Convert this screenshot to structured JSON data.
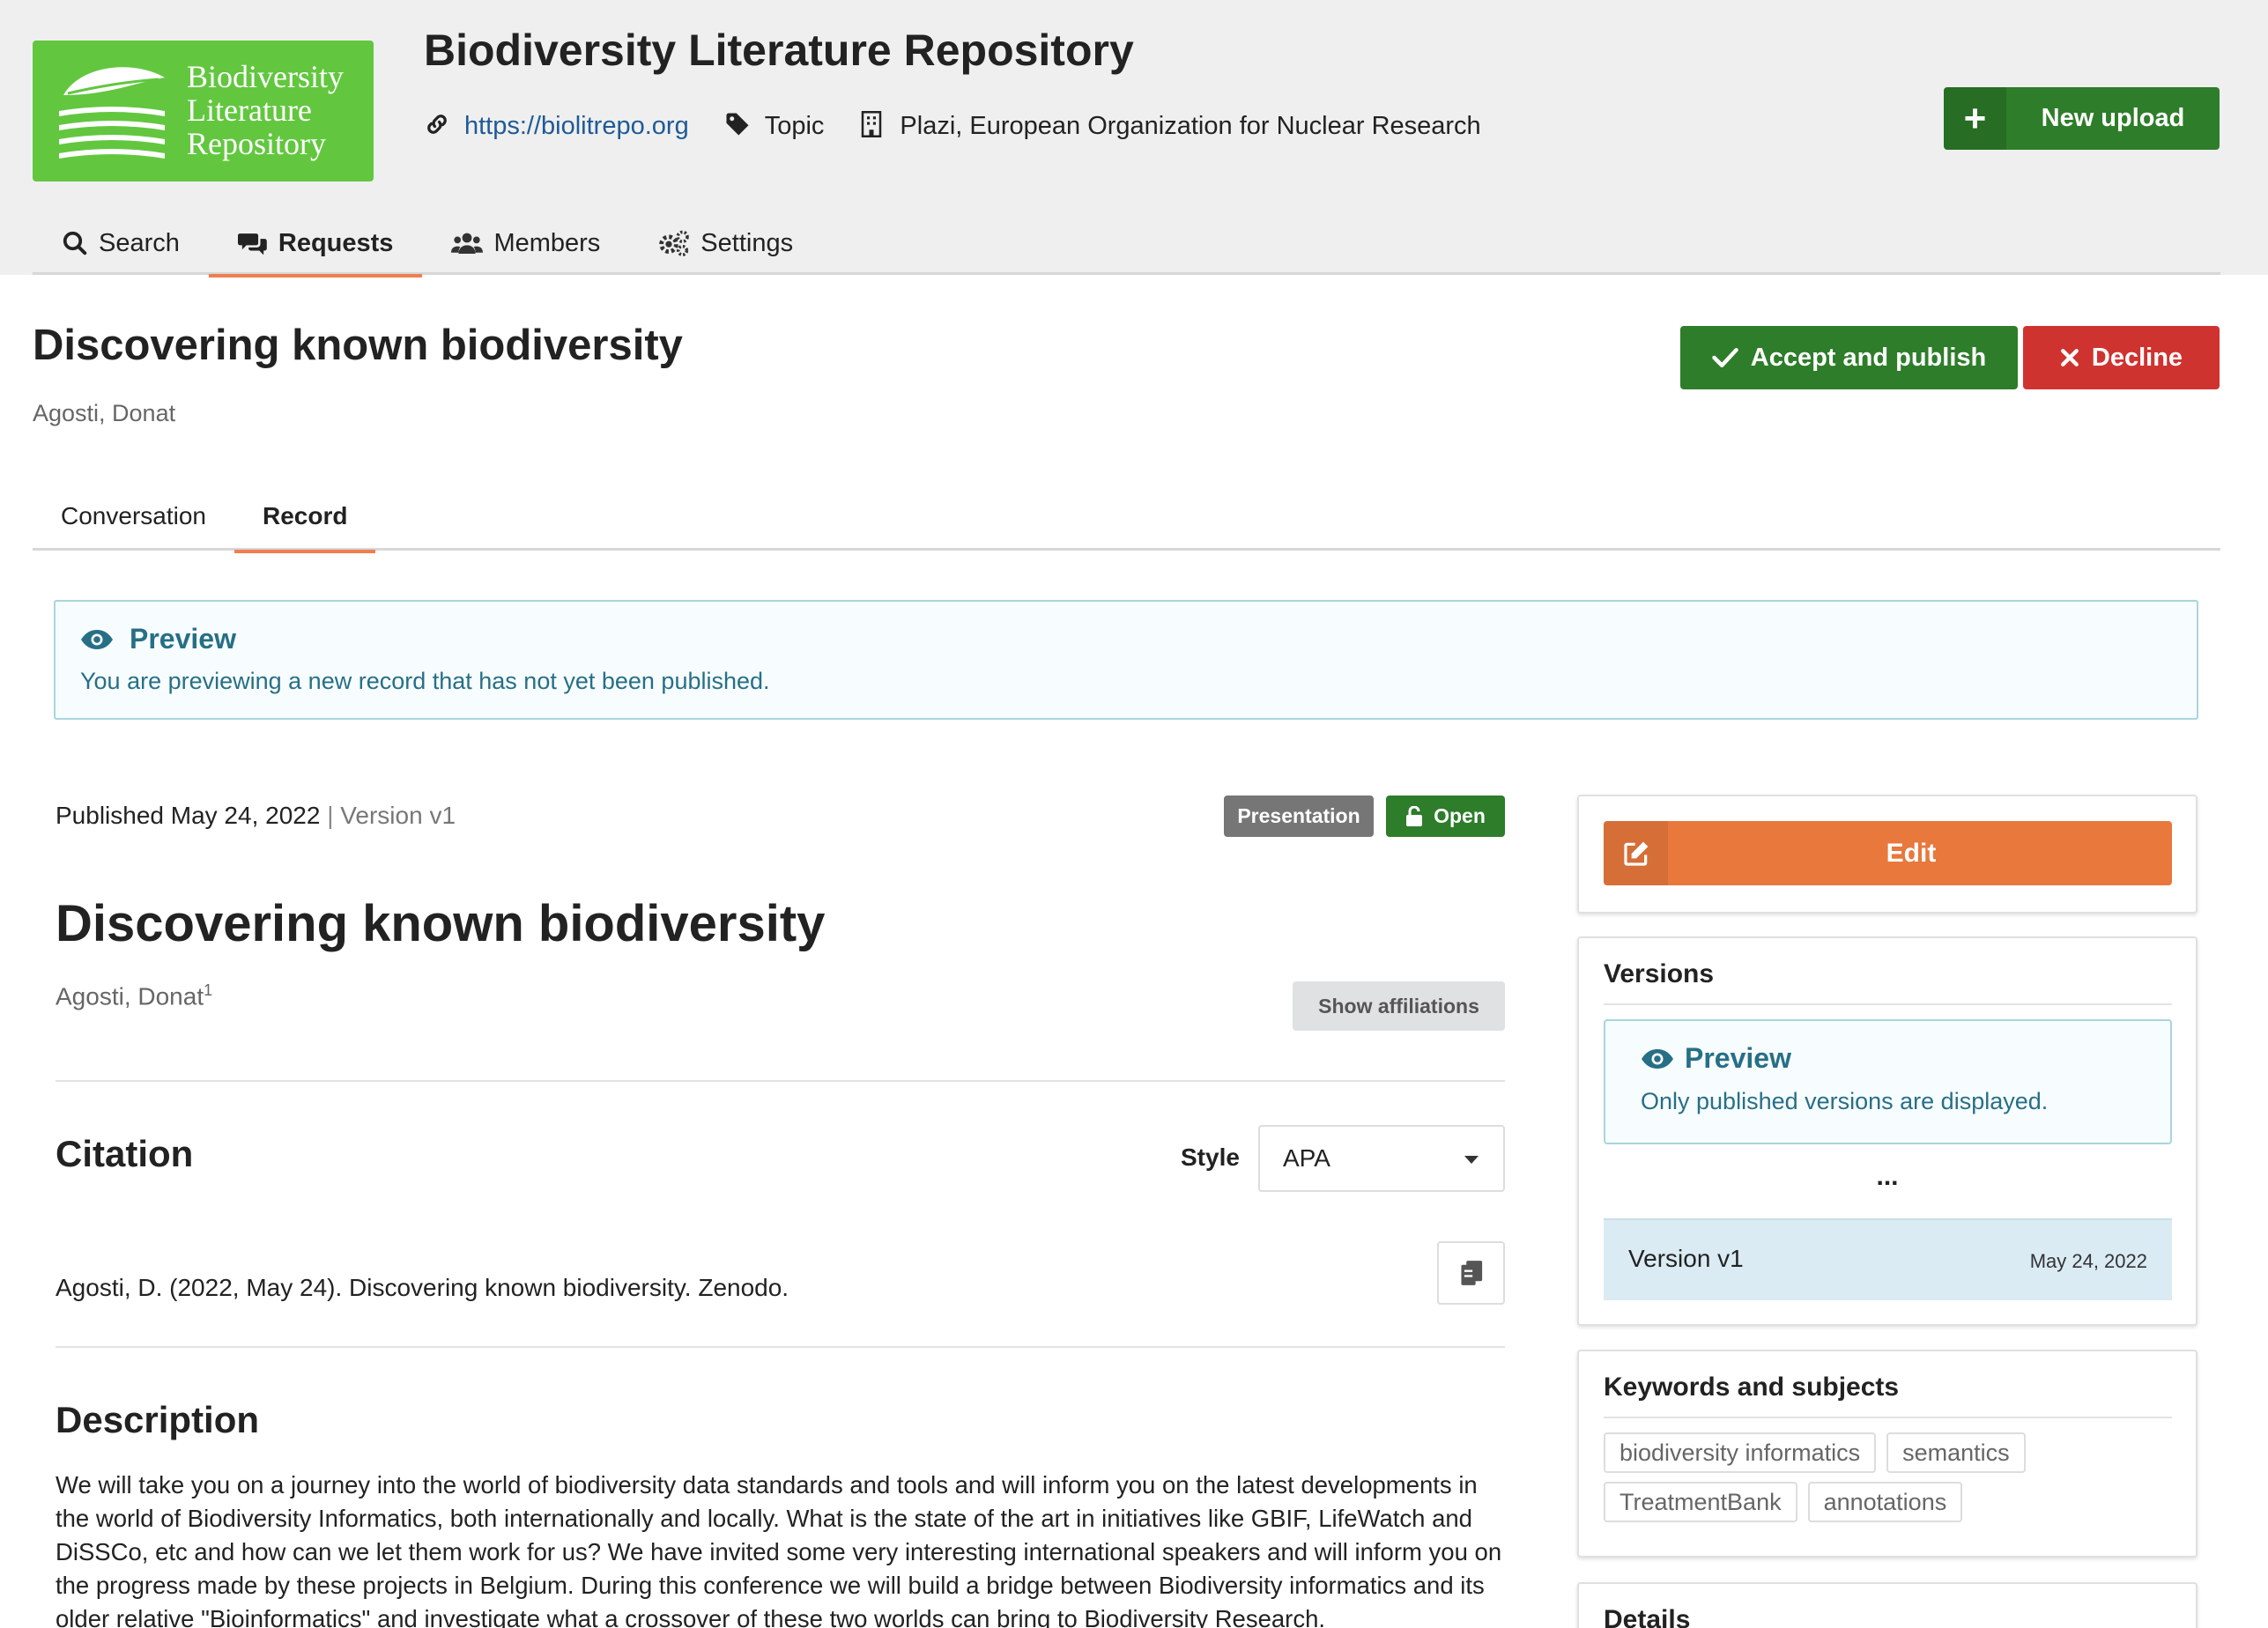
{
  "community": {
    "logo_lines": [
      "Biodiversity",
      "Literature",
      "Repository"
    ],
    "title": "Biodiversity Literature Repository",
    "url": "https://biolitrepo.org",
    "type": "Topic",
    "organizations": "Plazi, European Organization for Nuclear Research",
    "new_upload_label": "New upload"
  },
  "nav": {
    "items": [
      {
        "label": "Search",
        "icon": "search-icon"
      },
      {
        "label": "Requests",
        "icon": "comments-icon",
        "active": true
      },
      {
        "label": "Members",
        "icon": "users-icon"
      },
      {
        "label": "Settings",
        "icon": "cogs-icon"
      }
    ]
  },
  "request": {
    "title": "Discovering known biodiversity",
    "author": "Agosti, Donat",
    "accept_label": "Accept and publish",
    "decline_label": "Decline",
    "tabs": [
      {
        "label": "Conversation"
      },
      {
        "label": "Record",
        "active": true
      }
    ]
  },
  "preview_message": {
    "header": "Preview",
    "text": "You are previewing a new record that has not yet been published."
  },
  "record": {
    "published_label": "Published May 24, 2022",
    "separator": "|",
    "version_label": "Version v1",
    "resource_type": "Presentation",
    "access": "Open",
    "title": "Discovering known biodiversity",
    "creator": "Agosti, Donat",
    "creator_sup": "1",
    "show_affiliations_label": "Show affiliations",
    "citation": {
      "heading": "Citation",
      "style_label": "Style",
      "style_value": "APA",
      "text": "Agosti, D. (2022, May 24). Discovering known biodiversity. Zenodo."
    },
    "description": {
      "heading": "Description",
      "text": "We will take you on a journey into the world of biodiversity data standards and tools and will inform you on the latest developments in the world of Biodiversity Informatics, both internationally and locally. What is the state of the art in initiatives like GBIF, LifeWatch and DiSSCo, etc and how can we let them work for us? We have invited some very interesting international speakers and will inform you on the progress made by these projects in Belgium. During this conference we will build a bridge between Biodiversity informatics and its older relative \"Bioinformatics\" and investigate what a crossover of these two worlds can bring to Biodiversity Research."
    }
  },
  "sidebar": {
    "edit_label": "Edit",
    "versions": {
      "heading": "Versions",
      "preview_header": "Preview",
      "preview_text": "Only published versions are displayed.",
      "ellipsis": "...",
      "items": [
        {
          "name": "Version v1",
          "date": "May 24, 2022"
        }
      ]
    },
    "keywords": {
      "heading": "Keywords and subjects",
      "items": [
        "biodiversity informatics",
        "semantics",
        "TreatmentBank",
        "annotations"
      ]
    },
    "details": {
      "heading": "Details"
    }
  },
  "colors": {
    "logo_green": "#62c73f",
    "primary_green": "#2e7d2a",
    "danger_red": "#cf3330",
    "edit_orange": "#e8783c",
    "tab_accent": "#f07e4f",
    "info_text": "#276f86",
    "link_blue": "#1f5a96"
  }
}
